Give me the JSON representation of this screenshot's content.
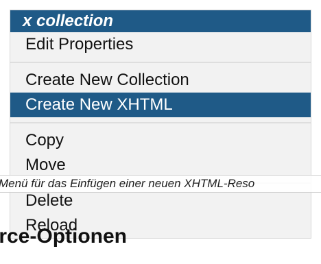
{
  "menu": {
    "title": "x collection",
    "items": [
      {
        "label": "Edit Properties",
        "selected": false
      },
      {
        "label": "Create New Collection",
        "selected": false
      },
      {
        "label": "Create New XHTML",
        "selected": true
      },
      {
        "label": "Copy",
        "selected": false
      },
      {
        "label": "Move",
        "selected": false
      },
      {
        "label": "Delete",
        "selected": false
      },
      {
        "label": "Reload",
        "selected": false
      }
    ]
  },
  "caption": "Menü für das Einfügen einer neuen XHTML-Reso",
  "section_title": "urce-Optionen",
  "colors": {
    "accent": "#1f5a87",
    "menu_background": "#f2f2f2"
  }
}
